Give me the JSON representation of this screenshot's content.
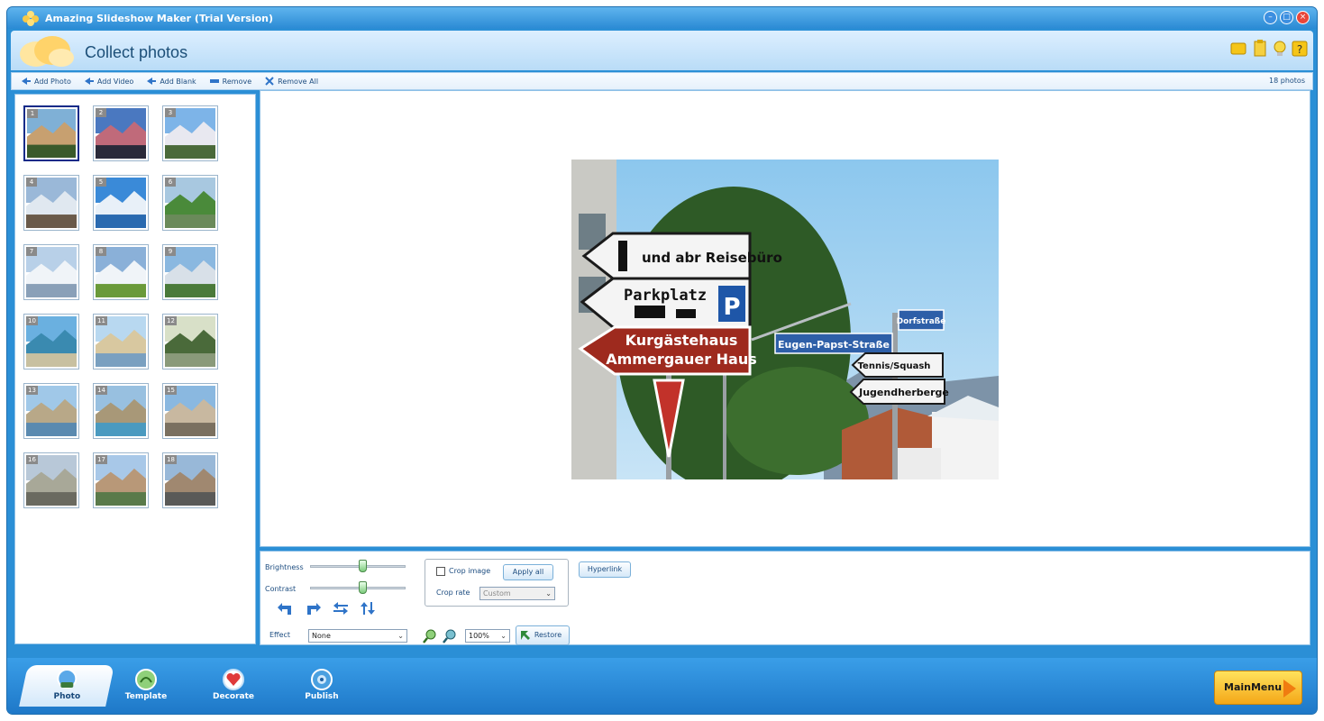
{
  "window": {
    "title": "Amazing Slideshow Maker (Trial Version)",
    "controls": {
      "minimize": "–",
      "maximize": "□",
      "close": "×"
    }
  },
  "header": {
    "title": "Collect photos",
    "icons": [
      "message-icon",
      "note-icon",
      "bulb-icon",
      "help-icon"
    ]
  },
  "toolbar": {
    "add_photo": "Add Photo",
    "add_video": "Add Video",
    "add_blank": "Add Blank",
    "remove": "Remove",
    "remove_all": "Remove All",
    "photo_count": "18 photos"
  },
  "thumbnails": [
    {
      "num": "1"
    },
    {
      "num": "2"
    },
    {
      "num": "3"
    },
    {
      "num": "4"
    },
    {
      "num": "5"
    },
    {
      "num": "6"
    },
    {
      "num": "7"
    },
    {
      "num": "8"
    },
    {
      "num": "9"
    },
    {
      "num": "10"
    },
    {
      "num": "11"
    },
    {
      "num": "12"
    },
    {
      "num": "13"
    },
    {
      "num": "14"
    },
    {
      "num": "15"
    },
    {
      "num": "16"
    },
    {
      "num": "17"
    },
    {
      "num": "18"
    }
  ],
  "selected_thumbnail": 1,
  "preview": {
    "signs": {
      "sign1": "und abr Reisebüro",
      "sign2": "Parkplatz",
      "sign2_letter": "P",
      "sign3_line1": "Kurgästehaus",
      "sign3_line2": "Ammergauer Haus",
      "sign4": "Eugen-Papst-Straße",
      "sign5": "Dorfstraße",
      "sign6": "Tennis/Squash",
      "sign7": "Jugendherberge"
    }
  },
  "controls": {
    "brightness_label": "Brightness",
    "brightness_value": 0.55,
    "contrast_label": "Contrast",
    "contrast_value": 0.55,
    "effect_label": "Effect",
    "effect_value": "None",
    "crop_image_label": "Crop image",
    "crop_image_checked": false,
    "apply_all_label": "Apply all",
    "crop_rate_label": "Crop rate",
    "crop_rate_value": "Custom",
    "hyperlink_label": "Hyperlink",
    "zoom_value": "100%",
    "restore_label": "Restore"
  },
  "nav": {
    "tabs": [
      {
        "label": "Photo",
        "active": true
      },
      {
        "label": "Template",
        "active": false
      },
      {
        "label": "Decorate",
        "active": false
      },
      {
        "label": "Publish",
        "active": false
      }
    ],
    "main_menu": "MainMenu"
  }
}
